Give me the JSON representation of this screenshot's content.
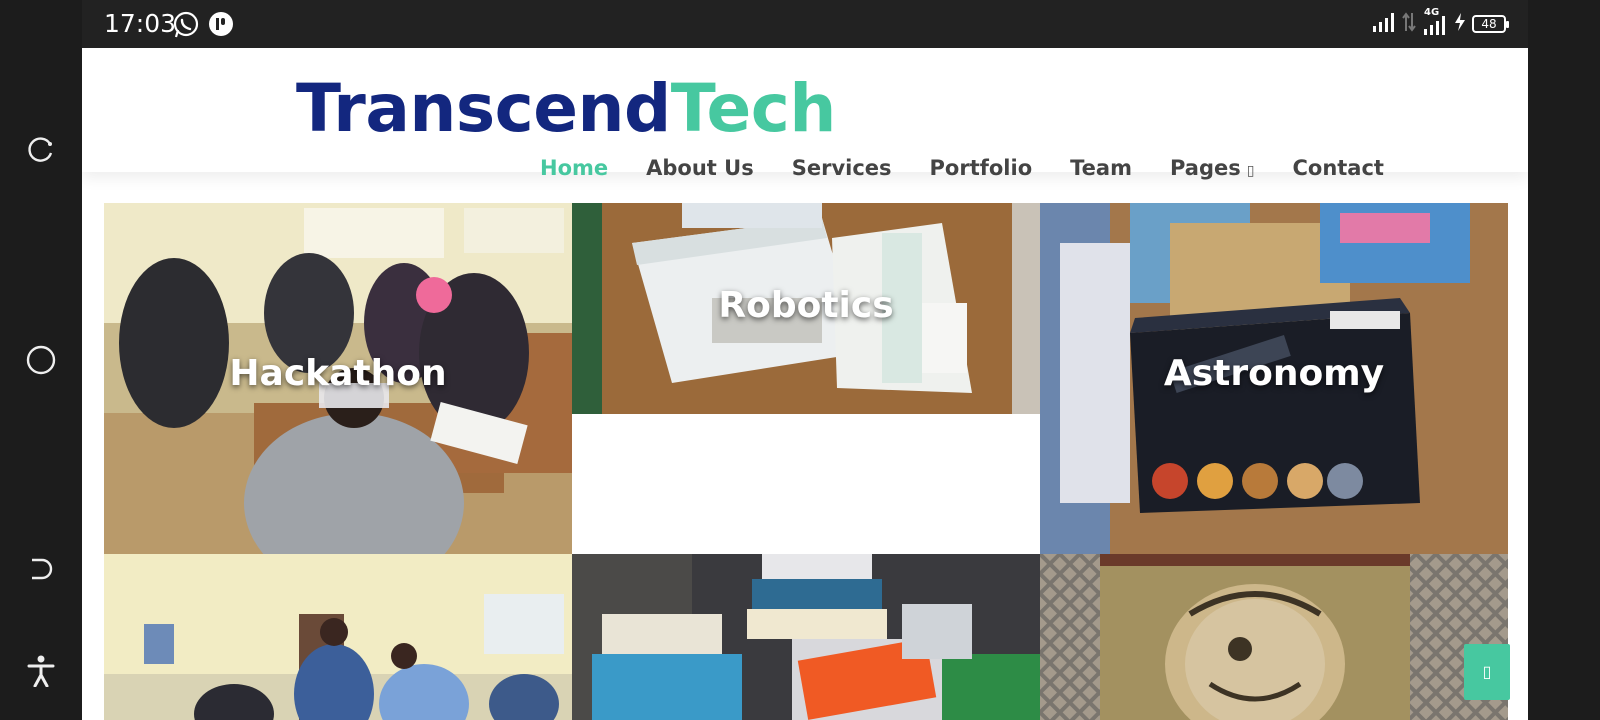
{
  "status_bar": {
    "time": "17:03",
    "network": "4G",
    "battery": "48"
  },
  "site": {
    "logo_part1": "Transcend",
    "logo_part2": "Tech",
    "nav": [
      {
        "label": "Home",
        "active": true
      },
      {
        "label": "About Us"
      },
      {
        "label": "Services"
      },
      {
        "label": "Portfolio"
      },
      {
        "label": "Team"
      },
      {
        "label": "Pages",
        "has_dropdown": true
      },
      {
        "label": "Contact"
      }
    ]
  },
  "gallery": [
    {
      "label": "Hackathon"
    },
    {
      "label": "Robotics"
    },
    {
      "label": "Astronomy"
    },
    {
      "label": ""
    },
    {
      "label": ""
    },
    {
      "label": ""
    }
  ],
  "colors": {
    "brand_navy": "#13277f",
    "brand_green": "#47c8a0"
  },
  "icons": {
    "scroll_top": "arrow-up-icon",
    "dropdown": "chevron-down-icon"
  }
}
